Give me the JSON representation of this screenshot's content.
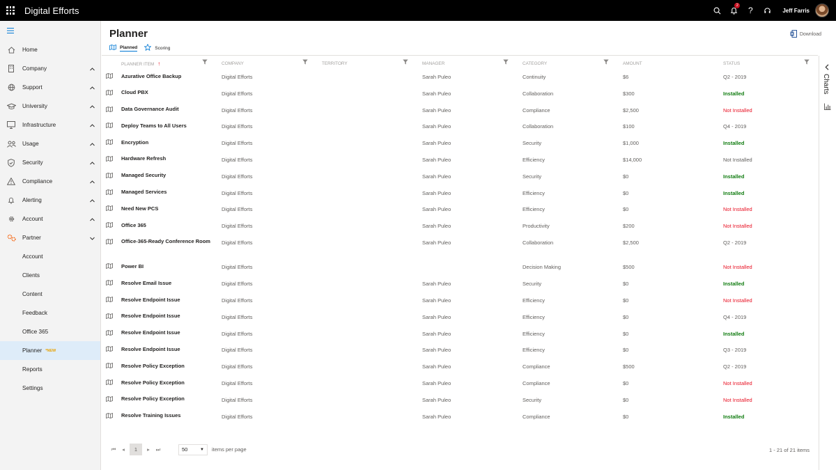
{
  "app": {
    "title": "Digital Efforts"
  },
  "topbar": {
    "user_name": "Jeff Farris",
    "notification_count": "2"
  },
  "sidebar": {
    "items": [
      {
        "label": "Home",
        "icon": "home-icon"
      },
      {
        "label": "Company",
        "icon": "building-icon"
      },
      {
        "label": "Support",
        "icon": "globe-icon"
      },
      {
        "label": "University",
        "icon": "graduation-cap-icon"
      },
      {
        "label": "Infrastructure",
        "icon": "monitor-icon"
      },
      {
        "label": "Usage",
        "icon": "people-icon"
      },
      {
        "label": "Security",
        "icon": "shield-icon"
      },
      {
        "label": "Compliance",
        "icon": "warning-icon"
      },
      {
        "label": "Alerting",
        "icon": "bell-icon"
      },
      {
        "label": "Account",
        "icon": "gear-icon"
      },
      {
        "label": "Partner",
        "icon": "partner-icon"
      }
    ],
    "partner_subitems": [
      {
        "label": "Account"
      },
      {
        "label": "Clients"
      },
      {
        "label": "Content"
      },
      {
        "label": "Feedback"
      },
      {
        "label": "Office 365"
      },
      {
        "label": "Planner",
        "badge": "*NEW"
      },
      {
        "label": "Reports"
      },
      {
        "label": "Settings"
      }
    ]
  },
  "page": {
    "title": "Planner",
    "download_label": "Download",
    "tabs": [
      {
        "label": "Planned"
      },
      {
        "label": "Scoring"
      }
    ]
  },
  "table": {
    "columns": [
      "Planner Item",
      "Company",
      "Territory",
      "Manager",
      "Category",
      "Amount",
      "Status"
    ],
    "rows": [
      {
        "item": "Azurative Office Backup",
        "company": "Digital Efforts",
        "territory": "",
        "manager": "Sarah Puleo",
        "category": "Continuity",
        "amount": "$6",
        "status": "Q2 - 2019",
        "status_kind": "plain"
      },
      {
        "item": "Cloud PBX",
        "company": "Digital Efforts",
        "territory": "",
        "manager": "Sarah Puleo",
        "category": "Collaboration",
        "amount": "$300",
        "status": "Installed",
        "status_kind": "installed"
      },
      {
        "item": "Data Governance Audit",
        "company": "Digital Efforts",
        "territory": "",
        "manager": "Sarah Puleo",
        "category": "Compliance",
        "amount": "$2,500",
        "status": "Not Installed",
        "status_kind": "not"
      },
      {
        "item": "Deploy Teams to All Users",
        "company": "Digital Efforts",
        "territory": "",
        "manager": "Sarah Puleo",
        "category": "Collaboration",
        "amount": "$100",
        "status": "Q4 - 2019",
        "status_kind": "plain"
      },
      {
        "item": "Encryption",
        "company": "Digital Efforts",
        "territory": "",
        "manager": "Sarah Puleo",
        "category": "Security",
        "amount": "$1,000",
        "status": "Installed",
        "status_kind": "installed"
      },
      {
        "item": "Hardware Refresh",
        "company": "Digital Efforts",
        "territory": "",
        "manager": "Sarah Puleo",
        "category": "Efficiency",
        "amount": "$14,000",
        "status": "Not Installed",
        "status_kind": "plain"
      },
      {
        "item": "Managed Security",
        "company": "Digital Efforts",
        "territory": "",
        "manager": "Sarah Puleo",
        "category": "Security",
        "amount": "$0",
        "status": "Installed",
        "status_kind": "installed"
      },
      {
        "item": "Managed Services",
        "company": "Digital Efforts",
        "territory": "",
        "manager": "Sarah Puleo",
        "category": "Efficiency",
        "amount": "$0",
        "status": "Installed",
        "status_kind": "installed"
      },
      {
        "item": "Need New PCS",
        "company": "Digital Efforts",
        "territory": "",
        "manager": "Sarah Puleo",
        "category": "Efficiency",
        "amount": "$0",
        "status": "Not Installed",
        "status_kind": "not"
      },
      {
        "item": "Office 365",
        "company": "Digital Efforts",
        "territory": "",
        "manager": "Sarah Puleo",
        "category": "Productivity",
        "amount": "$200",
        "status": "Not Installed",
        "status_kind": "not"
      },
      {
        "item": "Office-365-Ready Conference Room",
        "company": "Digital Efforts",
        "territory": "",
        "manager": "Sarah Puleo",
        "category": "Collaboration",
        "amount": "$2,500",
        "status": "Q2 - 2019",
        "status_kind": "plain",
        "tall": true
      },
      {
        "item": "Power BI",
        "company": "Digital Efforts",
        "territory": "",
        "manager": "",
        "category": "Decision Making",
        "amount": "$500",
        "status": "Not Installed",
        "status_kind": "not"
      },
      {
        "item": "Resolve Email Issue",
        "company": "Digital Efforts",
        "territory": "",
        "manager": "Sarah Puleo",
        "category": "Security",
        "amount": "$0",
        "status": "Installed",
        "status_kind": "installed"
      },
      {
        "item": "Resolve Endpoint Issue",
        "company": "Digital Efforts",
        "territory": "",
        "manager": "Sarah Puleo",
        "category": "Efficiency",
        "amount": "$0",
        "status": "Not Installed",
        "status_kind": "not"
      },
      {
        "item": "Resolve Endpoint Issue",
        "company": "Digital Efforts",
        "territory": "",
        "manager": "Sarah Puleo",
        "category": "Efficiency",
        "amount": "$0",
        "status": "Q4 - 2019",
        "status_kind": "plain"
      },
      {
        "item": "Resolve Endpoint Issue",
        "company": "Digital Efforts",
        "territory": "",
        "manager": "Sarah Puleo",
        "category": "Efficiency",
        "amount": "$0",
        "status": "Installed",
        "status_kind": "installed"
      },
      {
        "item": "Resolve Endpoint Issue",
        "company": "Digital Efforts",
        "territory": "",
        "manager": "Sarah Puleo",
        "category": "Efficiency",
        "amount": "$0",
        "status": "Q3 - 2019",
        "status_kind": "plain"
      },
      {
        "item": "Resolve Policy Exception",
        "company": "Digital Efforts",
        "territory": "",
        "manager": "Sarah Puleo",
        "category": "Compliance",
        "amount": "$500",
        "status": "Q2 - 2019",
        "status_kind": "plain"
      },
      {
        "item": "Resolve Policy Exception",
        "company": "Digital Efforts",
        "territory": "",
        "manager": "Sarah Puleo",
        "category": "Compliance",
        "amount": "$0",
        "status": "Not Installed",
        "status_kind": "not"
      },
      {
        "item": "Resolve Policy Exception",
        "company": "Digital Efforts",
        "territory": "",
        "manager": "Sarah Puleo",
        "category": "Security",
        "amount": "$0",
        "status": "Not Installed",
        "status_kind": "not"
      },
      {
        "item": "Resolve Training Issues",
        "company": "Digital Efforts",
        "territory": "",
        "manager": "Sarah Puleo",
        "category": "Compliance",
        "amount": "$0",
        "status": "Installed",
        "status_kind": "installed"
      }
    ]
  },
  "pager": {
    "current_page": "1",
    "page_size": "50",
    "per_page_label": "items per page",
    "summary": "1 - 21 of 21 items"
  },
  "rail": {
    "label": "Charts"
  },
  "colors": {
    "accent": "#0078d4",
    "installed": "#107c10",
    "not_installed": "#e81123",
    "new_badge": "#e8a200"
  }
}
